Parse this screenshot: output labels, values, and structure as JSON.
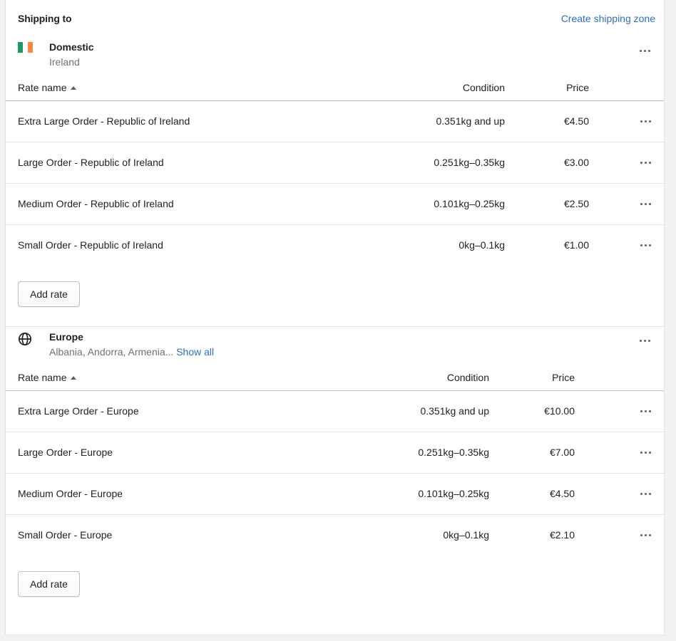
{
  "card": {
    "title": "Shipping to",
    "create_link": "Create shipping zone"
  },
  "colors": {
    "accent_link": "#2c6ecb",
    "text_primary": "#202223",
    "text_subdued": "#6d7175",
    "border": "#e1e3e5",
    "border_strong": "#babec3",
    "page_background": "#f1f2f3",
    "flag_green": "#169b62",
    "flag_white": "#ffffff",
    "flag_orange": "#ff883e"
  },
  "icons": {
    "flag_ireland": "flag-ireland-icon",
    "globe": "globe-icon",
    "kebab": "ellipsis-horizontal-icon",
    "sort_ascending": "sort-ascending-caret-icon"
  },
  "zones": [
    {
      "id": "domestic",
      "icon": "flag-ireland-icon",
      "name": "Domestic",
      "subtitle": "Ireland",
      "show_all_label": "",
      "columns": {
        "name": "Rate name",
        "condition": "Condition",
        "price": "Price"
      },
      "sort": "ascending",
      "rates": [
        {
          "name": "Extra Large Order - Republic of Ireland",
          "condition": "0.351kg and up",
          "price": "€4.50"
        },
        {
          "name": "Large Order - Republic of Ireland",
          "condition": "0.251kg–0.35kg",
          "price": "€3.00"
        },
        {
          "name": "Medium Order - Republic of Ireland",
          "condition": "0.101kg–0.25kg",
          "price": "€2.50"
        },
        {
          "name": "Small Order - Republic of Ireland",
          "condition": "0kg–0.1kg",
          "price": "€1.00"
        }
      ],
      "add_rate_label": "Add rate"
    },
    {
      "id": "europe",
      "icon": "globe-icon",
      "name": "Europe",
      "subtitle": "Albania, Andorra, Armenia...",
      "show_all_label": "Show all",
      "columns": {
        "name": "Rate name",
        "condition": "Condition",
        "price": "Price"
      },
      "sort": "ascending",
      "rates": [
        {
          "name": "Extra Large Order - Europe",
          "condition": "0.351kg and up",
          "price": "€10.00"
        },
        {
          "name": "Large Order - Europe",
          "condition": "0.251kg–0.35kg",
          "price": "€7.00"
        },
        {
          "name": "Medium Order - Europe",
          "condition": "0.101kg–0.25kg",
          "price": "€4.50"
        },
        {
          "name": "Small Order - Europe",
          "condition": "0kg–0.1kg",
          "price": "€2.10"
        }
      ],
      "add_rate_label": "Add rate"
    }
  ]
}
